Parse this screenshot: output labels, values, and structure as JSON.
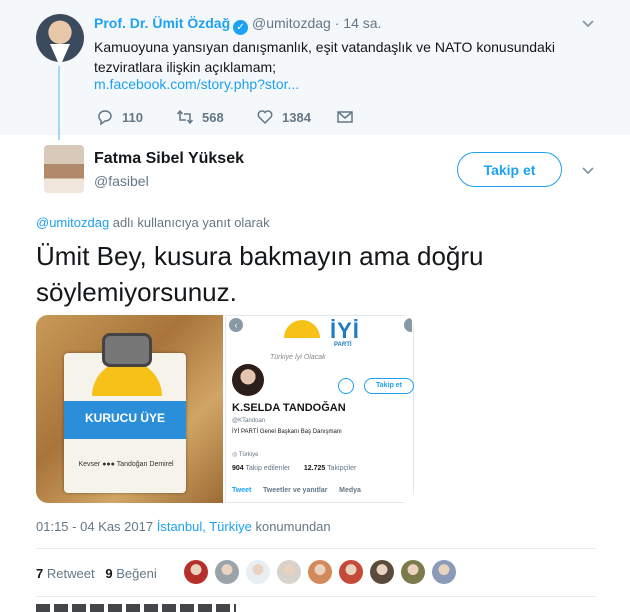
{
  "parent_tweet": {
    "author_name": "Prof. Dr. Ümit Özdağ",
    "verified_glyph": "✓",
    "handle": "@umitozdag",
    "separator": "·",
    "time": "14 sa.",
    "text": "Kamuoyuna yansıyan danışmanlık, eşit vatandaşlık ve NATO konusundaki tezviratlara ilişkin açıklamam;",
    "link": "m.facebook.com/story.php?stor...",
    "replies": "110",
    "retweets": "568",
    "likes": "1384",
    "icons": [
      "reply-icon",
      "retweet-icon",
      "like-icon",
      "direct-message-icon",
      "chevron-down-icon"
    ]
  },
  "tweet": {
    "author_name": "Fatma Sibel Yüksek",
    "handle": "@fasibel",
    "follow_label": "Takip et",
    "reply_mention": "@umitozdag",
    "reply_suffix": " adlı kullanıcıya yanıt olarak",
    "text": "Ümit Bey, kusura bakmayın ama doğru söylemiyorsunuz.",
    "timestamp": "01:15 - 04 Kas 2017",
    "location": "İstanbul, Türkiye",
    "location_suffix": " konumundan",
    "retweet_count": "7",
    "retweet_label": "Retweet",
    "like_count": "9",
    "like_label": "Beğeni"
  },
  "media": {
    "badge_title": "KURUCU ÜYE",
    "badge_name": "Kevser ●●● Tandoğan Demirel",
    "profile_logo": "İYİ",
    "profile_parti": "PARTİ",
    "profile_slogan": "Türkiye İyi Olacak",
    "profile_follow": "Takip et",
    "profile_name": "K.SELDA TANDOĞAN",
    "profile_handle": "@KTandoan",
    "profile_bio": "İYİ PARTİ Genel Başkanı Baş Danışmanı",
    "profile_location": "Türkiye",
    "following_count": "904",
    "following_label": "Takip edilenler",
    "followers_count": "12.725",
    "followers_label": "Takipçiler",
    "tab_tweets": "Tweet",
    "tab_replies": "Tweetler ve yanıtlar",
    "tab_media": "Medya"
  },
  "likers_colors": [
    "#b5302a",
    "#9aa3a8",
    "#e8eef2",
    "#d7d2cc",
    "#d38a5a",
    "#c44a3a",
    "#5a4a3c",
    "#7a7a4a",
    "#8a9ab8"
  ],
  "accent_color": "#1da1f2"
}
